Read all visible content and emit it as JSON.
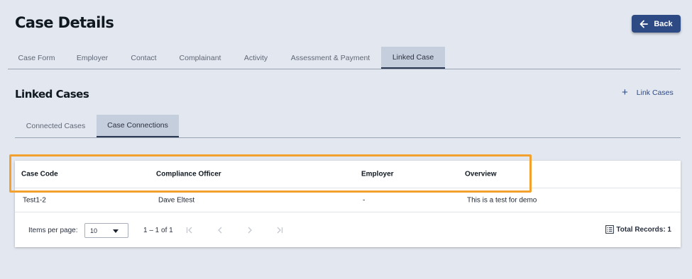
{
  "header": {
    "title": "Case Details",
    "back_label": "Back"
  },
  "main_tabs": [
    {
      "label": "Case Form",
      "active": false
    },
    {
      "label": "Employer",
      "active": false
    },
    {
      "label": "Contact",
      "active": false
    },
    {
      "label": "Complainant",
      "active": false
    },
    {
      "label": "Activity",
      "active": false
    },
    {
      "label": "Assessment & Payment",
      "active": false
    },
    {
      "label": "Linked Case",
      "active": true
    }
  ],
  "section": {
    "title": "Linked Cases",
    "link_cases_label": "Link Cases"
  },
  "sub_tabs": [
    {
      "label": "Connected Cases",
      "active": false
    },
    {
      "label": "Case Connections",
      "active": true
    }
  ],
  "table": {
    "columns": [
      "Case Code",
      "Compliance Officer",
      "Employer",
      "Overview"
    ],
    "rows": [
      [
        "Test1-2",
        "Dave Eltest",
        "-",
        "This is a test for demo"
      ]
    ]
  },
  "paginator": {
    "items_per_page_label": "Items per page:",
    "page_size": "10",
    "range_label": "1 – 1 of 1",
    "total_records_label": "Total Records: 1"
  },
  "colors": {
    "accent": "#2d4a85",
    "highlight": "#f3a12e",
    "active_tab_bg": "#c5cedc",
    "page_bg": "#e3e7ef"
  }
}
